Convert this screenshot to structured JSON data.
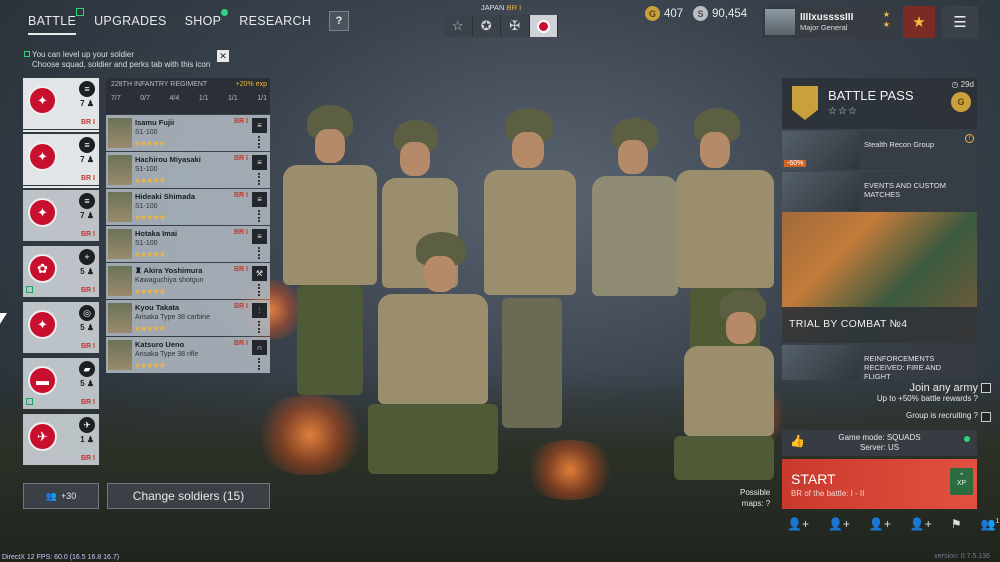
{
  "nav": {
    "tabs": [
      {
        "label": "BATTLE"
      },
      {
        "label": "UPGRADES"
      },
      {
        "label": "SHOP"
      },
      {
        "label": "RESEARCH"
      }
    ],
    "help_label": "?"
  },
  "notice": {
    "line1": "You can level up your soldier",
    "line2": "Choose squad, soldier and perks tab with this icon",
    "close": "✕"
  },
  "army": {
    "nation": "JAPAN",
    "br": "BR I",
    "icons": [
      "star-icon",
      "star-circle-icon",
      "cross-icon",
      "japan-flag-icon"
    ]
  },
  "currency": {
    "gold": "407",
    "silver": "90,454"
  },
  "profile": {
    "name": "IIIIxussssIII",
    "rank": "Major General"
  },
  "squads": [
    {
      "count": "7",
      "br": "BR I"
    },
    {
      "count": "7",
      "br": "BR I"
    },
    {
      "count": "7",
      "br": "BR I"
    },
    {
      "count": "5",
      "br": "BR I"
    },
    {
      "count": "5",
      "br": "BR I"
    },
    {
      "count": "5",
      "br": "BR I"
    },
    {
      "count": "1",
      "br": "BR I"
    }
  ],
  "regiment": {
    "title": "228TH INFANTRY REGIMENT",
    "exp": "+20% exp",
    "stats": [
      "7/7",
      "0/7",
      "4/4",
      "1/1",
      "1/1",
      "1/1"
    ]
  },
  "soldiers": [
    {
      "name": "Isamu Fujii",
      "weapon": "S1-100",
      "br": "BR I"
    },
    {
      "name": "Hachirou Miyasaki",
      "weapon": "S1-100",
      "br": "BR I"
    },
    {
      "name": "Hideaki Shimada",
      "weapon": "S1-100",
      "br": "BR I"
    },
    {
      "name": "Hotaka Imai",
      "weapon": "S1-100",
      "br": "BR I"
    },
    {
      "name": "Akira Yoshimura",
      "weapon": "Kawaguchiya shotgun",
      "br": "BR I"
    },
    {
      "name": "Kyou Takata",
      "weapon": "Arisaka Type 38 carbine",
      "br": "BR I"
    },
    {
      "name": "Katsuro Ueno",
      "weapon": "Arisaka Type 38 rifle",
      "br": "BR I"
    }
  ],
  "stars": "★★★★★",
  "bottom_left": {
    "add_count": "+30",
    "change_label": "Change soldiers (15)"
  },
  "battle_pass": {
    "title": "BATTLE PASS",
    "stars": "☆☆☆",
    "days": "29d"
  },
  "events": [
    {
      "label": "Stealth Recon Group",
      "discount": "-60%"
    },
    {
      "label": "EVENTS AND CUSTOM MATCHES"
    }
  ],
  "trial": {
    "label": "TRIAL BY COMBAT №4"
  },
  "reinforcements": {
    "label": "REINFORCEMENTS RECEIVED: FIRE AND FLIGHT"
  },
  "options": {
    "join_any": "Join any army",
    "join_any_sub": "Up to +50% battle rewards",
    "recruiting": "Group is recruiting"
  },
  "mode": {
    "line1": "Game mode: SQUADS",
    "line2": "Server: US"
  },
  "start": {
    "label": "START",
    "sub": "BR of the battle: I - II",
    "xp": "XP"
  },
  "maps": {
    "line1": "Possible",
    "line2": "maps:"
  },
  "bottom_icons_badge": "1",
  "version": "version: 0.7.5.136",
  "debug": "DirectX 12 FPS: 60.0 (16.5 16.8 16.7)"
}
